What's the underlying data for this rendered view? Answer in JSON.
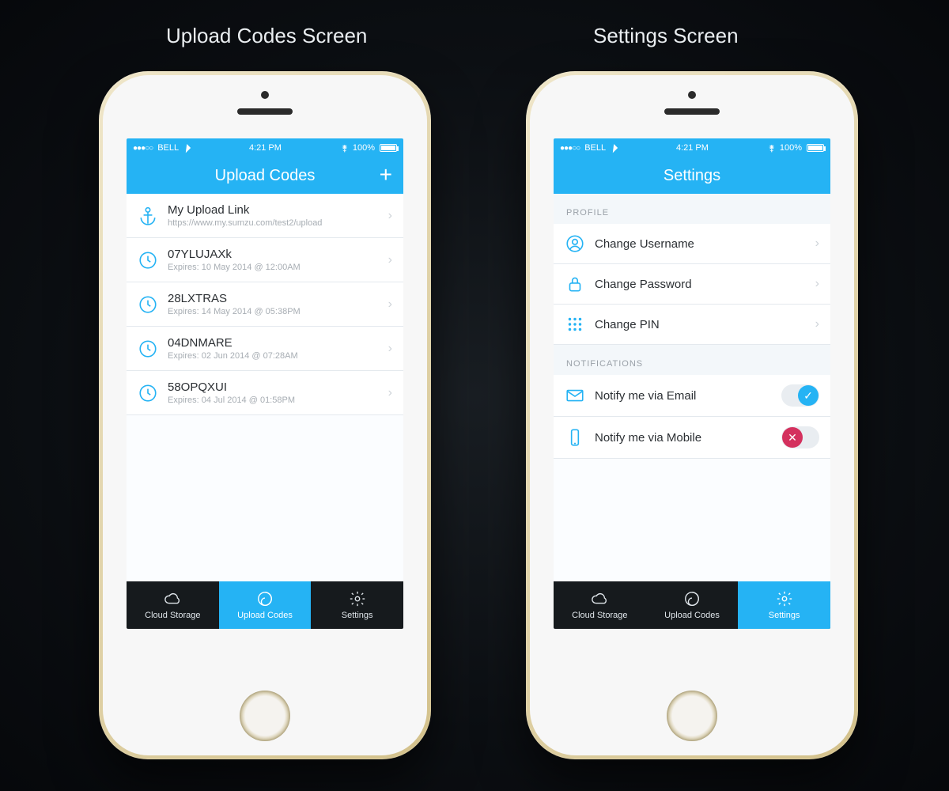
{
  "colors": {
    "accent": "#25b3f4",
    "danger": "#d4315e"
  },
  "titles": {
    "left": "Upload Codes Screen",
    "right": "Settings Screen"
  },
  "statusbar": {
    "carrier": "BELL",
    "time": "4:21 PM",
    "battery": "100%",
    "signal_dots": "●●●○○"
  },
  "tabbar": {
    "items": [
      {
        "label": "Cloud Storage",
        "icon": "cloud-icon"
      },
      {
        "label": "Upload Codes",
        "icon": "swirl-icon"
      },
      {
        "label": "Settings",
        "icon": "gear-icon"
      }
    ]
  },
  "screens": {
    "upload": {
      "title": "Upload Codes",
      "add_label": "+",
      "rows": [
        {
          "icon": "anchor-icon",
          "primary": "My Upload Link",
          "secondary": "https://www.my.sumzu.com/test2/upload"
        },
        {
          "icon": "timer-icon",
          "primary": "07YLUJAXk",
          "secondary": "Expires: 10 May 2014 @ 12:00AM"
        },
        {
          "icon": "timer-icon",
          "primary": "28LXTRAS",
          "secondary": "Expires: 14 May 2014 @ 05:38PM"
        },
        {
          "icon": "timer-icon",
          "primary": "04DNMARE",
          "secondary": "Expires: 02 Jun 2014 @ 07:28AM"
        },
        {
          "icon": "timer-icon",
          "primary": "58OPQXUI",
          "secondary": "Expires: 04 Jul 2014 @ 01:58PM"
        }
      ],
      "active_tab": 1
    },
    "settings": {
      "title": "Settings",
      "sections": {
        "profile": {
          "header": "PROFILE",
          "rows": [
            {
              "icon": "user-icon",
              "label": "Change Username"
            },
            {
              "icon": "lock-icon",
              "label": "Change Password"
            },
            {
              "icon": "keypad-icon",
              "label": "Change PIN"
            }
          ]
        },
        "notifications": {
          "header": "NOTIFICATIONS",
          "rows": [
            {
              "icon": "mail-icon",
              "label": "Notify me via Email",
              "on": true
            },
            {
              "icon": "mobile-icon",
              "label": "Notify me via Mobile",
              "on": false
            }
          ]
        }
      },
      "active_tab": 2
    }
  }
}
